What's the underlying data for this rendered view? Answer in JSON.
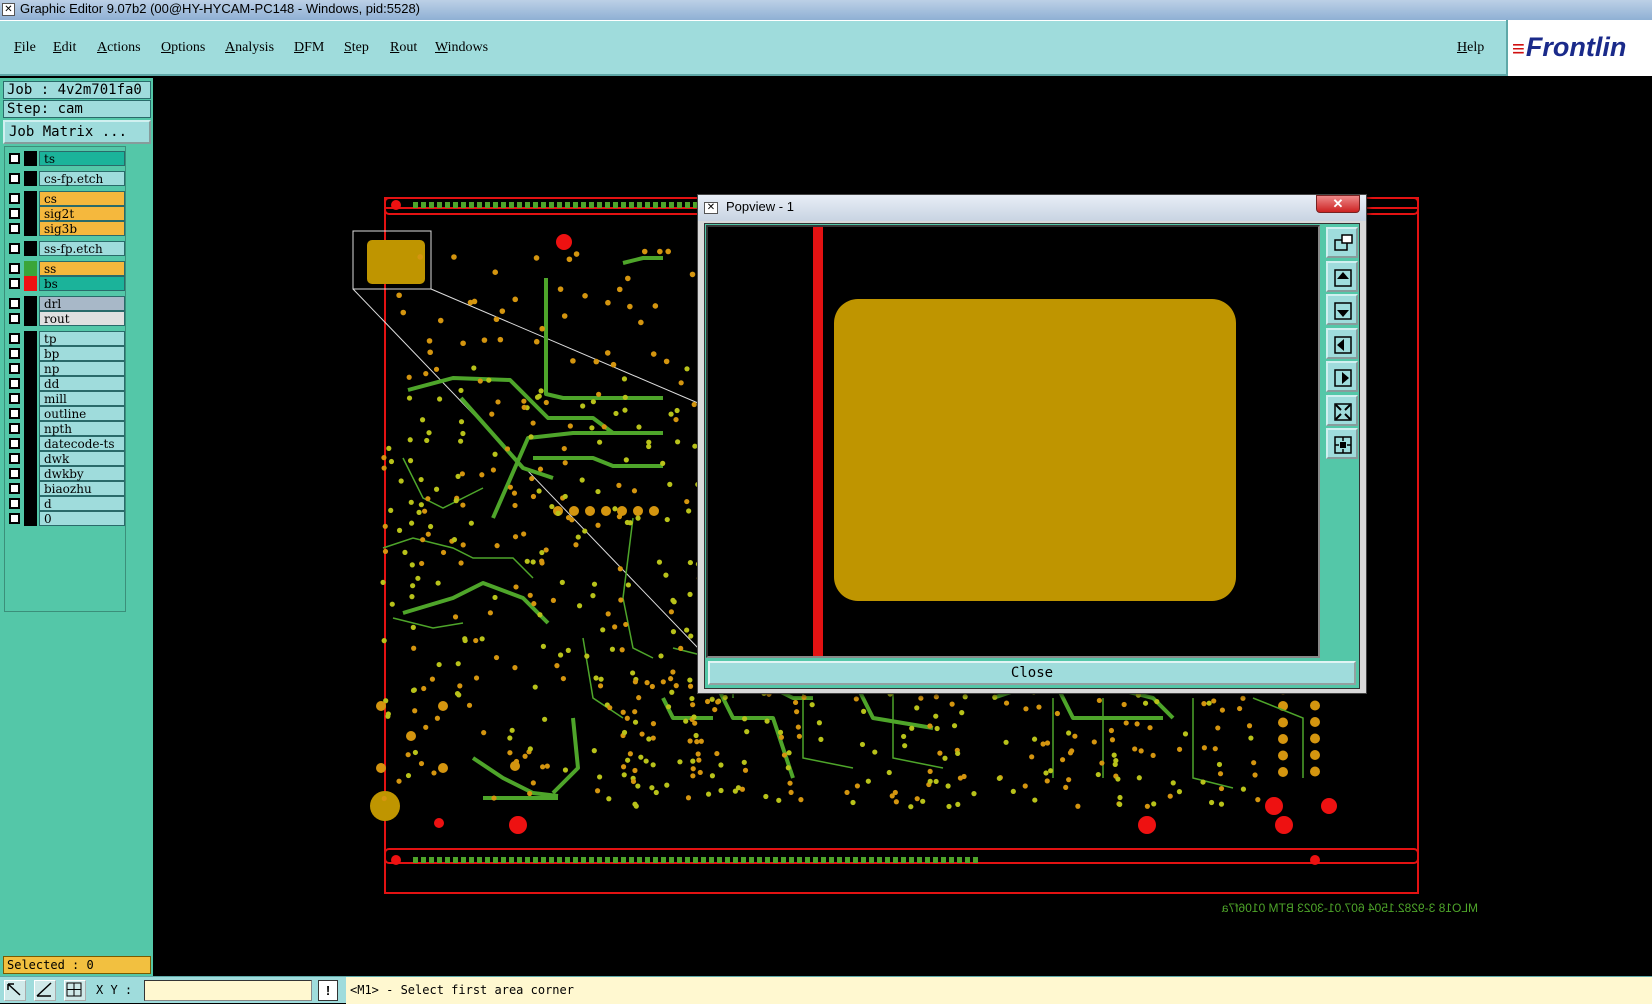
{
  "window": {
    "title": "Graphic Editor 9.07b2 (00@HY-HYCAM-PC148 - Windows, pid:5528)"
  },
  "menu": {
    "items": [
      "File",
      "Edit",
      "Actions",
      "Options",
      "Analysis",
      "DFM",
      "Step",
      "Rout",
      "Windows"
    ],
    "help": "Help",
    "logo": "Frontlin"
  },
  "job": {
    "job_line": "Job : 4v2m701fa0",
    "step_line": "Step: cam",
    "matrix_button": "Job Matrix ..."
  },
  "layers": [
    {
      "name": "ts",
      "color": "#1bb39a",
      "swatch": "#000000",
      "group": 0
    },
    {
      "name": "cs-fp.etch",
      "color": "#9fdcdc",
      "swatch": "#000000",
      "group": 1
    },
    {
      "name": "cs",
      "color": "#f5b83d",
      "swatch": "#000000",
      "group": 2
    },
    {
      "name": "sig2t",
      "color": "#f5b83d",
      "swatch": "#000000",
      "group": 2
    },
    {
      "name": "sig3b",
      "color": "#f5b83d",
      "swatch": "#000000",
      "group": 2
    },
    {
      "name": "ss-fp.etch",
      "color": "#9fdcdc",
      "swatch": "#000000",
      "group": 3
    },
    {
      "name": "ss",
      "color": "#f5b83d",
      "swatch": "#3aa53a",
      "group": 4
    },
    {
      "name": "bs",
      "color": "#1bb39a",
      "swatch": "#ee1111",
      "group": 4
    },
    {
      "name": "drl",
      "color": "#a8b8c8",
      "swatch": "#000000",
      "group": 5
    },
    {
      "name": "rout",
      "color": "#e0e0e0",
      "swatch": "#000000",
      "group": 5
    },
    {
      "name": "tp",
      "color": "#9fdcdc",
      "swatch": "#000000",
      "group": 6
    },
    {
      "name": "bp",
      "color": "#9fdcdc",
      "swatch": "#000000",
      "group": 6
    },
    {
      "name": "np",
      "color": "#9fdcdc",
      "swatch": "#000000",
      "group": 6
    },
    {
      "name": "dd",
      "color": "#9fdcdc",
      "swatch": "#000000",
      "group": 6
    },
    {
      "name": "mill",
      "color": "#9fdcdc",
      "swatch": "#000000",
      "group": 6
    },
    {
      "name": "outline",
      "color": "#9fdcdc",
      "swatch": "#000000",
      "group": 6
    },
    {
      "name": "npth",
      "color": "#9fdcdc",
      "swatch": "#000000",
      "group": 6
    },
    {
      "name": "datecode-ts",
      "color": "#9fdcdc",
      "swatch": "#000000",
      "group": 6
    },
    {
      "name": "dwk",
      "color": "#9fdcdc",
      "swatch": "#000000",
      "group": 6
    },
    {
      "name": "dwkby",
      "color": "#9fdcdc",
      "swatch": "#000000",
      "group": 6
    },
    {
      "name": "biaozhu",
      "color": "#9fdcdc",
      "swatch": "#000000",
      "group": 6
    },
    {
      "name": "d",
      "color": "#9fdcdc",
      "swatch": "#000000",
      "group": 6
    },
    {
      "name": "0",
      "color": "#9fdcdc",
      "swatch": "#000000",
      "group": 6
    }
  ],
  "status": {
    "selected": "Selected : 0",
    "xy_label": "X Y :",
    "xy_value": "",
    "exclamation": "!",
    "message": "<M1> - Select first area corner"
  },
  "board": {
    "bottom_text": "MLO18    3-9282.1504    607.01-3023    BTM 0106f7a",
    "colors": {
      "trace": "#4ea52a",
      "pad": "#d4950f",
      "copper": "#bf9500",
      "outline": "#e31212",
      "drill": "#ee1111"
    }
  },
  "popup": {
    "title": "Popview - 1",
    "close_label": "Close",
    "close_x": "✕",
    "tool_icons": [
      "popup-window-icon",
      "zoom-in-icon",
      "zoom-out-icon",
      "pan-left-icon",
      "pan-right-icon",
      "zoom-fit-icon",
      "zoom-home-icon"
    ]
  }
}
